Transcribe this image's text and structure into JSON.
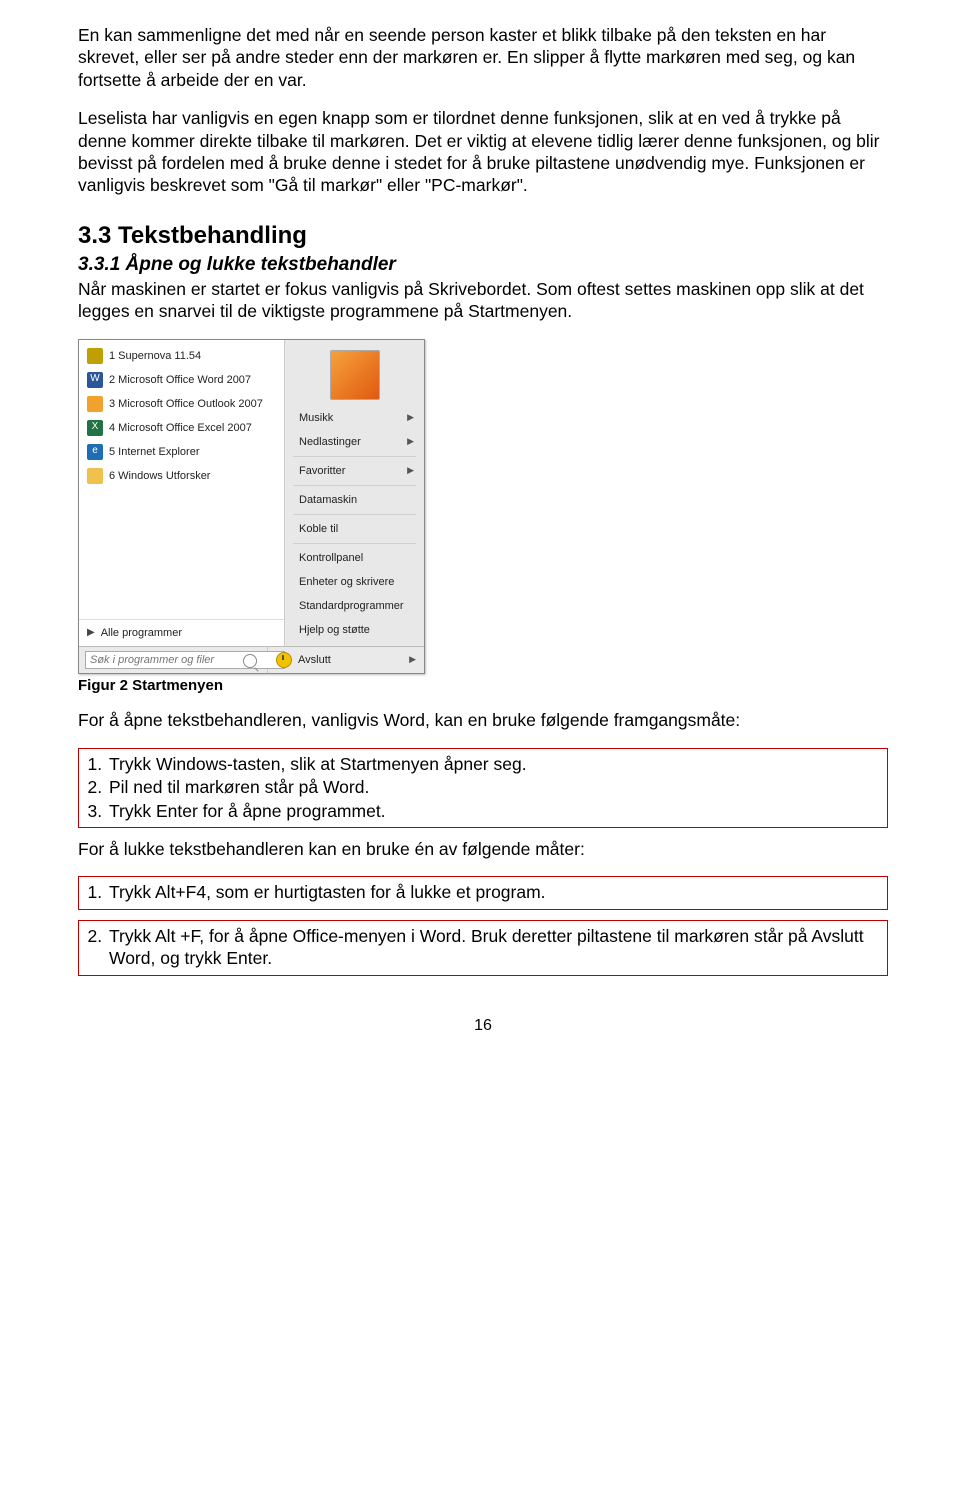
{
  "para1": "En kan sammenligne det med når en seende person kaster et blikk tilbake på den teksten en har skrevet, eller ser på andre steder enn der markøren er. En slipper å flytte markøren med seg, og kan fortsette å arbeide der en var.",
  "para2": "Leselista har vanligvis en egen knapp som er tilordnet denne funksjonen, slik at en ved å trykke på denne kommer direkte tilbake til markøren. Det er viktig at elevene tidlig lærer denne funksjonen, og blir bevisst på fordelen med å bruke denne i stedet for å bruke piltastene unødvendig mye. Funksjonen er vanligvis beskrevet som \"Gå til markør\" eller \"PC-markør\".",
  "h2": "3.3 Tekstbehandling",
  "h3": "3.3.1 Åpne og lukke tekstbehandler",
  "para3": "Når maskinen er startet er fokus vanligvis på Skrivebordet. Som oftest settes maskinen opp slik at det legges en snarvei til de viktigste programmene på Startmenyen.",
  "caption": "Figur 2 Startmenyen",
  "para4": "For å åpne tekstbehandleren, vanligvis Word, kan en bruke følgende framgangsmåte:",
  "list1": {
    "i1": "Trykk Windows-tasten, slik at Startmenyen åpner seg.",
    "i2": "Pil ned til markøren står på Word.",
    "i3": "Trykk Enter for å åpne programmet."
  },
  "para5": "For å lukke tekstbehandleren kan en bruke én av følgende måter:",
  "list2": {
    "i1": "Trykk Alt+F4, som er hurtigtasten for å lukke et program."
  },
  "list3": {
    "i1": "Trykk Alt +F, for å åpne Office-menyen i Word. Bruk deretter piltastene til markøren står på Avslutt Word, og trykk Enter."
  },
  "pagenum": "16",
  "startmenu": {
    "left": {
      "i1": "1 Supernova 11.54",
      "i2": "2 Microsoft Office Word 2007",
      "i3": "3 Microsoft Office Outlook 2007",
      "i4": "4 Microsoft Office Excel 2007",
      "i5": "5 Internet Explorer",
      "i6": "6 Windows Utforsker",
      "all": "Alle programmer"
    },
    "right": {
      "r1": "Musikk",
      "r2": "Nedlastinger",
      "r3": "Favoritter",
      "r4": "Datamaskin",
      "r5": "Koble til",
      "r6": "Kontrollpanel",
      "r7": "Enheter og skrivere",
      "r8": "Standardprogrammer",
      "r9": "Hjelp og støtte"
    },
    "search_placeholder": "Søk i programmer og filer",
    "shutdown": "Avslutt"
  }
}
